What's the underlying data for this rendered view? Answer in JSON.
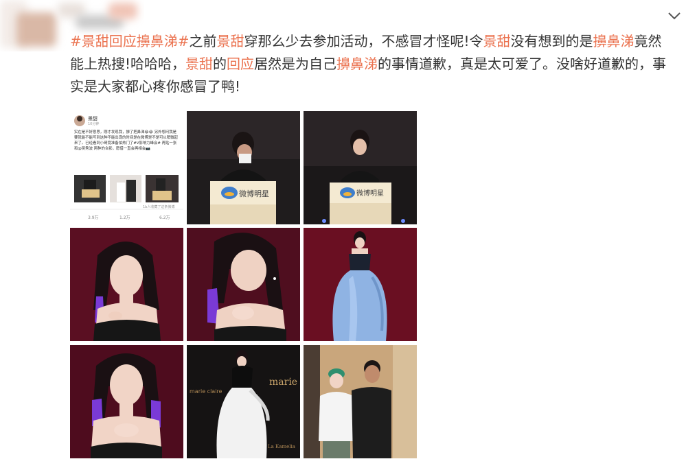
{
  "post": {
    "tag": "#景甜回应擤鼻涕#",
    "segments": [
      {
        "t": "之前",
        "k": false
      },
      {
        "t": "景甜",
        "k": true
      },
      {
        "t": "穿那么少去参加活动，不感冒才怪呢!令",
        "k": false
      },
      {
        "t": "景甜",
        "k": true
      },
      {
        "t": "没有想到的是",
        "k": false
      },
      {
        "t": "擤鼻涕",
        "k": true
      },
      {
        "t": "竟然能上热搜!哈哈哈，",
        "k": false
      },
      {
        "t": "景甜",
        "k": true
      },
      {
        "t": "的",
        "k": false
      },
      {
        "t": "回应",
        "k": true
      },
      {
        "t": "居然是为自己",
        "k": false
      },
      {
        "t": "擤鼻涕",
        "k": true
      },
      {
        "t": "的事情道歉，真是太可爱了。没啥好道歉的，事实是大家都心疼你感冒了鸭!",
        "k": false
      }
    ]
  },
  "embedded_post": {
    "name": "景甜",
    "time": "10分钟",
    "body": "实在是不好意思，刚才发现我，擤了把鼻涕😂😂 另外想问我是要就能不能写到这种不能出现的时间是在微博是不是可以稍微起来了。已经看到小哥竟准备拍热门了#V影响力峰会# 再贴一张和@吴秀波 两种的合影，愿借一直会再相会📷",
    "fav": "1b人收藏了这条微博",
    "stats": [
      "3.9万",
      "1.2万",
      "6.2万"
    ]
  },
  "photo_texts": {
    "podium_logo": "微博明星",
    "backdrop_brand": "marie",
    "backdrop_small": "marie claire",
    "backdrop_side": "La Kamelia"
  },
  "colors": {
    "keyword": "#eb7350",
    "text": "#333333"
  },
  "icons": {
    "dropdown": "chevron-down-icon"
  }
}
